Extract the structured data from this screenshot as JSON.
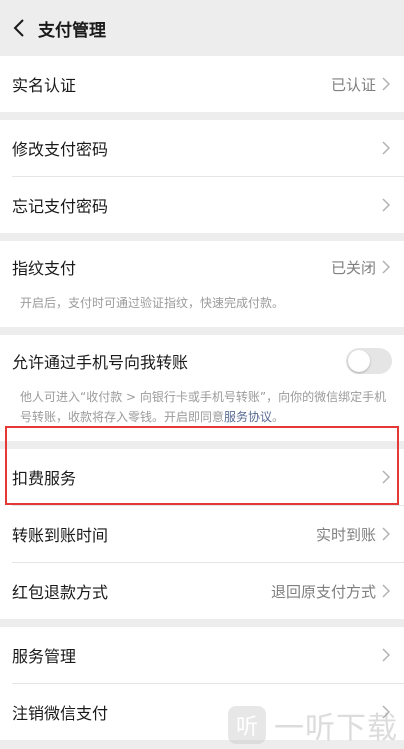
{
  "nav": {
    "title": "支付管理"
  },
  "rows": {
    "real_name": {
      "label": "实名认证",
      "value": "已认证"
    },
    "change_pwd": {
      "label": "修改支付密码"
    },
    "forgot_pwd": {
      "label": "忘记支付密码"
    },
    "fingerprint": {
      "label": "指纹支付",
      "value": "已关闭",
      "desc": "开启后，支付时可通过验证指纹，快速完成付款。"
    },
    "phone_transfer": {
      "label": "允许通过手机号向我转账",
      "toggle_on": false,
      "desc_prefix": "他人可进入“收付款 > 向银行卡或手机号转账”，向你的微信绑定手机号转账，收款将存入零钱。开启即同意",
      "desc_link": "服务协议",
      "desc_suffix": "。"
    },
    "deduction": {
      "label": "扣费服务"
    },
    "transfer_time": {
      "label": "转账到账时间",
      "value": "实时到账"
    },
    "red_packet_refund": {
      "label": "红包退款方式",
      "value": "退回原支付方式"
    },
    "service_manage": {
      "label": "服务管理"
    },
    "cancel_pay": {
      "label": "注销微信支付"
    }
  },
  "watermark": {
    "text": "一听下载",
    "logo_char": "听"
  },
  "colors": {
    "link": "#576b95",
    "highlight": "#e53935",
    "background": "#ededed"
  }
}
